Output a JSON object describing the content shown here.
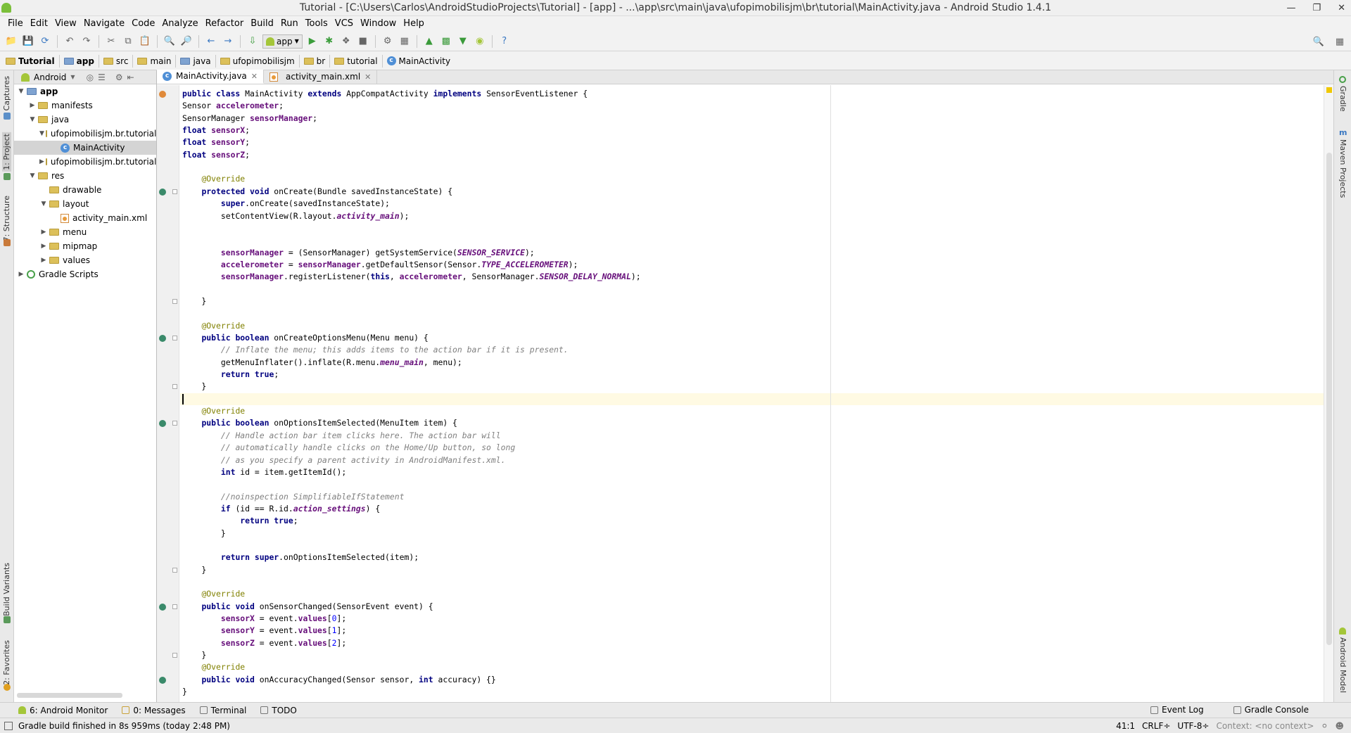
{
  "window": {
    "title": "Tutorial - [C:\\Users\\Carlos\\AndroidStudioProjects\\Tutorial] - [app] - ...\\app\\src\\main\\java\\ufopimobilisjm\\br\\tutorial\\MainActivity.java - Android Studio 1.4.1"
  },
  "menu": [
    "File",
    "Edit",
    "View",
    "Navigate",
    "Code",
    "Analyze",
    "Refactor",
    "Build",
    "Run",
    "Tools",
    "VCS",
    "Window",
    "Help"
  ],
  "toolbar": {
    "run_config": "app"
  },
  "breadcrumbs": [
    "Tutorial",
    "app",
    "src",
    "main",
    "java",
    "ufopimobilisjm",
    "br",
    "tutorial",
    "MainActivity"
  ],
  "left_tabs": {
    "captures": "Captures",
    "project": "1: Project",
    "structure": "7: Structure",
    "build_variants": "Build Variants",
    "favorites": "2: Favorites"
  },
  "project_panel": {
    "view": "Android"
  },
  "tree": [
    {
      "label": "app",
      "level": 0,
      "type": "module",
      "expanded": true
    },
    {
      "label": "manifests",
      "level": 1,
      "type": "folder",
      "expanded": false
    },
    {
      "label": "java",
      "level": 1,
      "type": "folder",
      "expanded": true
    },
    {
      "label": "ufopimobilisjm.br.tutorial",
      "level": 2,
      "type": "package",
      "expanded": true
    },
    {
      "label": "MainActivity",
      "level": 3,
      "type": "class",
      "selected": true
    },
    {
      "label": "ufopimobilisjm.br.tutorial",
      "level": 2,
      "type": "package",
      "expanded": false
    },
    {
      "label": "res",
      "level": 1,
      "type": "folder",
      "expanded": true
    },
    {
      "label": "drawable",
      "level": 2,
      "type": "folder"
    },
    {
      "label": "layout",
      "level": 2,
      "type": "folder",
      "expanded": true
    },
    {
      "label": "activity_main.xml",
      "level": 3,
      "type": "xml"
    },
    {
      "label": "menu",
      "level": 2,
      "type": "folder",
      "expanded": false
    },
    {
      "label": "mipmap",
      "level": 2,
      "type": "folder",
      "expanded": false
    },
    {
      "label": "values",
      "level": 2,
      "type": "folder",
      "expanded": false
    },
    {
      "label": "Gradle Scripts",
      "level": 0,
      "type": "gradle",
      "expanded": false
    }
  ],
  "editor_tabs": [
    {
      "label": "MainActivity.java",
      "active": true
    },
    {
      "label": "activity_main.xml",
      "active": false
    }
  ],
  "code_lines": [
    "<span class=\"kw\">public class</span> MainActivity <span class=\"kw\">extends</span> AppCompatActivity <span class=\"kw\">implements</span> SensorEventListener {",
    "Sensor <span class=\"fld\">accelerometer</span>;",
    "SensorManager <span class=\"fld\">sensorManager</span>;",
    "<span class=\"kw\">float</span> <span class=\"fld\">sensorX</span>;",
    "<span class=\"kw\">float</span> <span class=\"fld\">sensorY</span>;",
    "<span class=\"kw\">float</span> <span class=\"fld\">sensorZ</span>;",
    "",
    "    <span class=\"ann\">@Override</span>",
    "    <span class=\"kw\">protected void</span> onCreate(Bundle savedInstanceState) {",
    "        <span class=\"kw\">super</span>.onCreate(savedInstanceState);",
    "        setContentView(R.layout.<span class=\"sfld\">activity_main</span>);",
    "",
    "",
    "        <span class=\"fld\">sensorManager</span> = (SensorManager) getSystemService(<span class=\"sfld\">SENSOR_SERVICE</span>);",
    "        <span class=\"fld\">accelerometer</span> = <span class=\"fld\">sensorManager</span>.getDefaultSensor(Sensor.<span class=\"sfld\">TYPE_ACCELEROMETER</span>);",
    "        <span class=\"fld\">sensorManager</span>.registerListener(<span class=\"kw\">this</span>, <span class=\"fld\">accelerometer</span>, SensorManager.<span class=\"sfld\">SENSOR_DELAY_NORMAL</span>);",
    "",
    "    }",
    "",
    "    <span class=\"ann\">@Override</span>",
    "    <span class=\"kw\">public boolean</span> onCreateOptionsMenu(Menu menu) {",
    "        <span class=\"cmt\">// Inflate the menu; this adds items to the action bar if it is present.</span>",
    "        getMenuInflater().inflate(R.menu.<span class=\"sfld\">menu_main</span>, menu);",
    "        <span class=\"kw\">return true</span>;",
    "    }",
    "",
    "    <span class=\"ann\">@Override</span>",
    "    <span class=\"kw\">public boolean</span> onOptionsItemSelected(MenuItem item) {",
    "        <span class=\"cmt\">// Handle action bar item clicks here. The action bar will</span>",
    "        <span class=\"cmt\">// automatically handle clicks on the Home/Up button, so long</span>",
    "        <span class=\"cmt\">// as you specify a parent activity in AndroidManifest.xml.</span>",
    "        <span class=\"kw\">int</span> id = item.getItemId();",
    "",
    "        <span class=\"cmt\">//noinspection SimplifiableIfStatement</span>",
    "        <span class=\"kw\">if</span> (id == R.id.<span class=\"sfld\">action_settings</span>) {",
    "            <span class=\"kw\">return true</span>;",
    "        }",
    "",
    "        <span class=\"kw\">return super</span>.onOptionsItemSelected(item);",
    "    }",
    "",
    "    <span class=\"ann\">@Override</span>",
    "    <span class=\"kw\">public void</span> onSensorChanged(SensorEvent event) {",
    "        <span class=\"fld\">sensorX</span> = event.<span class=\"fld\">values</span>[<span class=\"num\">0</span>];",
    "        <span class=\"fld\">sensorY</span> = event.<span class=\"fld\">values</span>[<span class=\"num\">1</span>];",
    "        <span class=\"fld\">sensorZ</span> = event.<span class=\"fld\">values</span>[<span class=\"num\">2</span>];",
    "    }",
    "    <span class=\"ann\">@Override</span>",
    "    <span class=\"kw\">public void</span> onAccuracyChanged(Sensor sensor, <span class=\"kw\">int</span> accuracy) {}",
    "}"
  ],
  "cursor_line": 25,
  "right_tabs": {
    "gradle": "Gradle",
    "maven": "Maven Projects",
    "android_model": "Android Model"
  },
  "bottom_tabs": {
    "android_monitor": "6: Android Monitor",
    "messages": "0: Messages",
    "terminal": "Terminal",
    "todo": "TODO",
    "event_log": "Event Log",
    "gradle_console": "Gradle Console"
  },
  "status": {
    "message": "Gradle build finished in 8s 959ms (today 2:48 PM)",
    "position": "41:1",
    "line_sep": "CRLF÷",
    "encoding": "UTF-8÷",
    "context": "Context: <no context>"
  }
}
